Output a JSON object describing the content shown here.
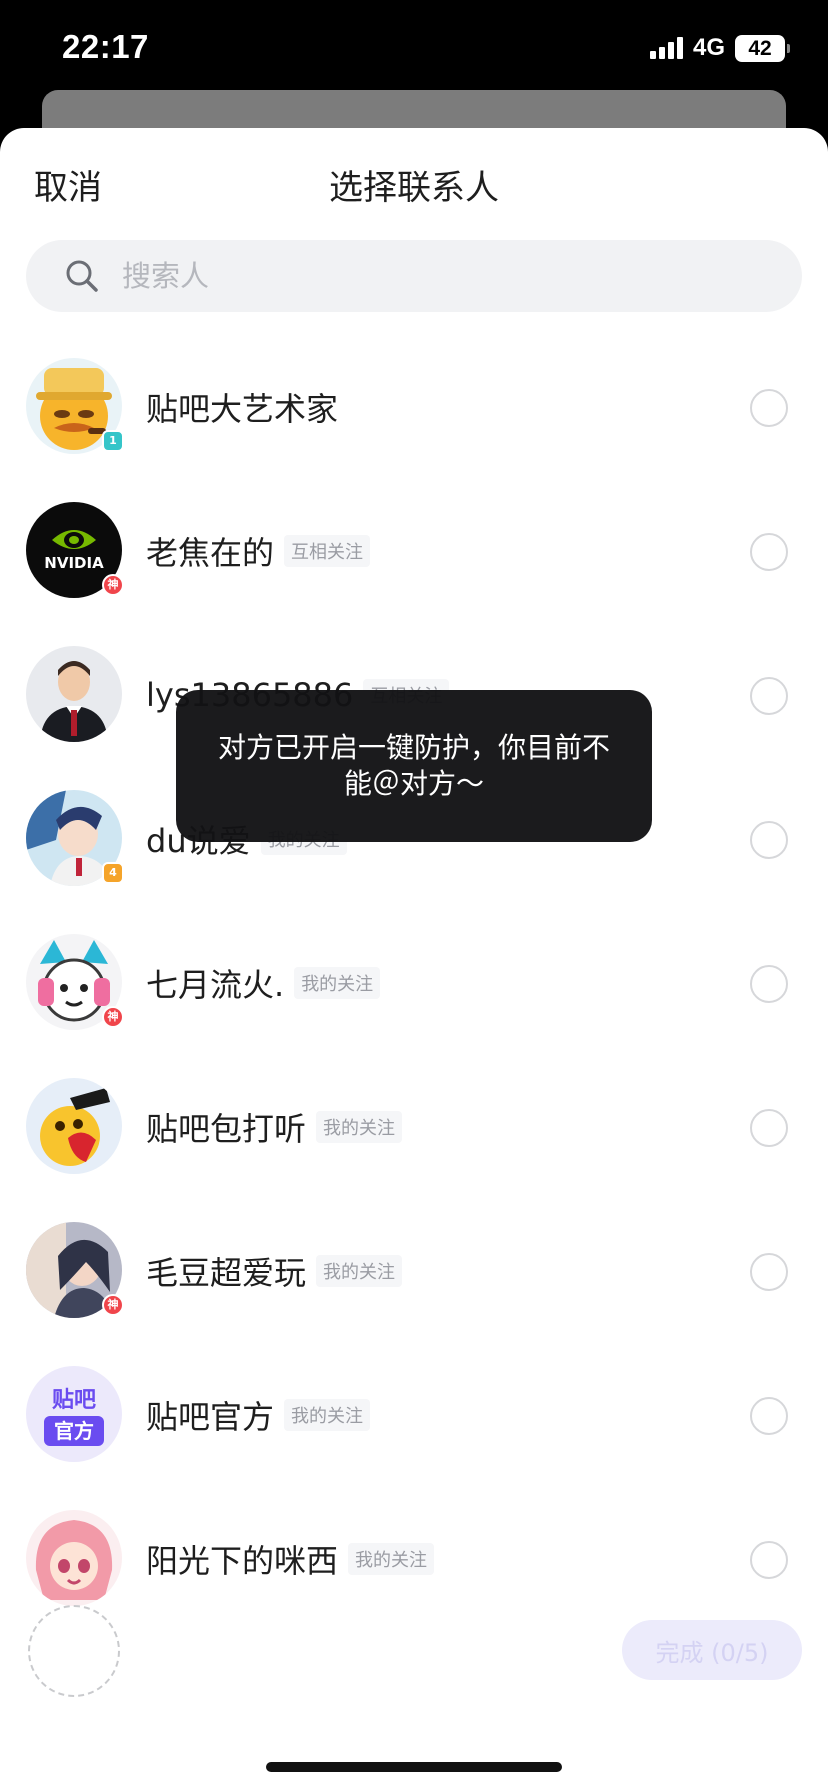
{
  "status_bar": {
    "time": "22:17",
    "network": "4G",
    "battery": "42"
  },
  "header": {
    "cancel_label": "取消",
    "title": "选择联系人"
  },
  "search": {
    "placeholder": "搜索人"
  },
  "contacts": [
    {
      "name": "贴吧大艺术家",
      "tag": "",
      "badge": "1"
    },
    {
      "name": "老焦在的",
      "tag": "互相关注",
      "badge": "神"
    },
    {
      "name": "lys13865886",
      "tag": "互相关注",
      "badge": ""
    },
    {
      "name": "du说爱",
      "tag": "我的关注",
      "badge": "4"
    },
    {
      "name": "七月流火.",
      "tag": "我的关注",
      "badge": "神"
    },
    {
      "name": "贴吧包打听",
      "tag": "我的关注",
      "badge": ""
    },
    {
      "name": "毛豆超爱玩",
      "tag": "我的关注",
      "badge": "神"
    },
    {
      "name": "贴吧官方",
      "tag": "我的关注",
      "badge": ""
    },
    {
      "name": "阳光下的咪西",
      "tag": "我的关注",
      "badge": ""
    }
  ],
  "avatar_text": {
    "nvidia": "NVIDIA",
    "official_top": "贴吧",
    "official_bottom": "官方"
  },
  "toast": {
    "message": "对方已开启一键防护，你目前不能＠对方～"
  },
  "footer": {
    "done_label": "完成 (0/5)"
  },
  "colors": {
    "accent_light": "#ecebfb",
    "badge_god": "#f0454b",
    "badge_level_teal": "#35c5c9",
    "badge_level_orange": "#f5a42a"
  }
}
